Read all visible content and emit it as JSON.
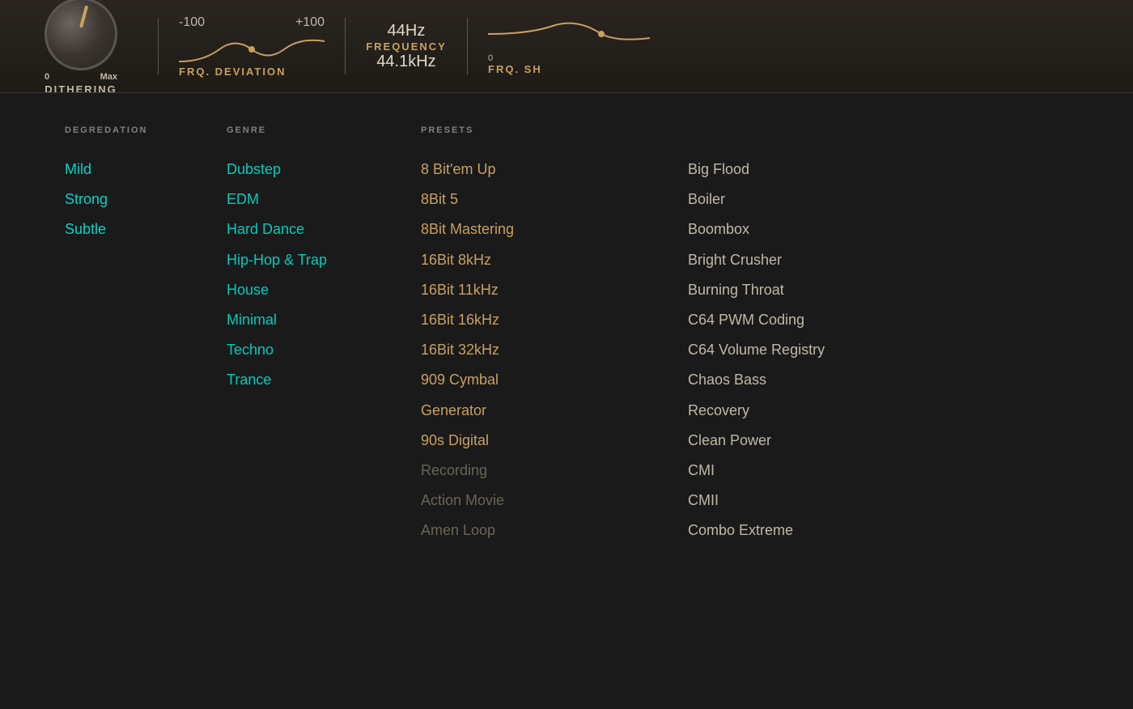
{
  "topPanel": {
    "dithering": {
      "label": "DITHERING",
      "min": "0",
      "max": "Max"
    },
    "frqDeviation": {
      "label": "FRQ. DEVIATION",
      "min": "-100",
      "max": "+100"
    },
    "frequency": {
      "label": "FREQUENCY",
      "hzValue": "44Hz",
      "khzValue": "44.1kHz"
    },
    "frqSh": {
      "label": "FRQ. SH"
    }
  },
  "sections": {
    "degradation": {
      "header": "DEGREDATION",
      "items": [
        {
          "label": "Mild",
          "style": "active"
        },
        {
          "label": "Strong",
          "style": "active"
        },
        {
          "label": "Subtle",
          "style": "active"
        }
      ]
    },
    "genre": {
      "header": "GENRE",
      "items": [
        {
          "label": "Dubstep",
          "style": "active"
        },
        {
          "label": "EDM",
          "style": "active"
        },
        {
          "label": "Hard Dance",
          "style": "active"
        },
        {
          "label": "Hip-Hop & Trap",
          "style": "active"
        },
        {
          "label": "House",
          "style": "active"
        },
        {
          "label": "Minimal",
          "style": "active"
        },
        {
          "label": "Techno",
          "style": "active"
        },
        {
          "label": "Trance",
          "style": "active"
        }
      ]
    },
    "presetsLeft": {
      "header": "PRESETS",
      "items": [
        {
          "label": "8 Bit'em Up",
          "style": "active"
        },
        {
          "label": "8Bit 5",
          "style": "active"
        },
        {
          "label": "8Bit Mastering",
          "style": "active"
        },
        {
          "label": "16Bit 8kHz",
          "style": "active"
        },
        {
          "label": "16Bit 11kHz",
          "style": "active"
        },
        {
          "label": "16Bit 16kHz",
          "style": "active"
        },
        {
          "label": "16Bit 32kHz",
          "style": "active"
        },
        {
          "label": "909 Cymbal",
          "style": "active"
        },
        {
          "label": "Generator",
          "style": "active"
        },
        {
          "label": "90s Digital",
          "style": "active"
        },
        {
          "label": "Recording",
          "style": "inactive"
        },
        {
          "label": "Action Movie",
          "style": "inactive"
        },
        {
          "label": "Amen Loop",
          "style": "inactive"
        }
      ]
    },
    "presetsRight": {
      "items": [
        {
          "label": "Big Flood"
        },
        {
          "label": "Boiler"
        },
        {
          "label": "Boombox"
        },
        {
          "label": "Bright Crusher"
        },
        {
          "label": "Burning Throat"
        },
        {
          "label": "C64 PWM Coding"
        },
        {
          "label": "C64 Volume Registry"
        },
        {
          "label": "Chaos Bass"
        },
        {
          "label": "Recovery"
        },
        {
          "label": "Clean Power"
        },
        {
          "label": "CMI"
        },
        {
          "label": "CMII"
        },
        {
          "label": "Combo Extreme"
        }
      ]
    }
  }
}
